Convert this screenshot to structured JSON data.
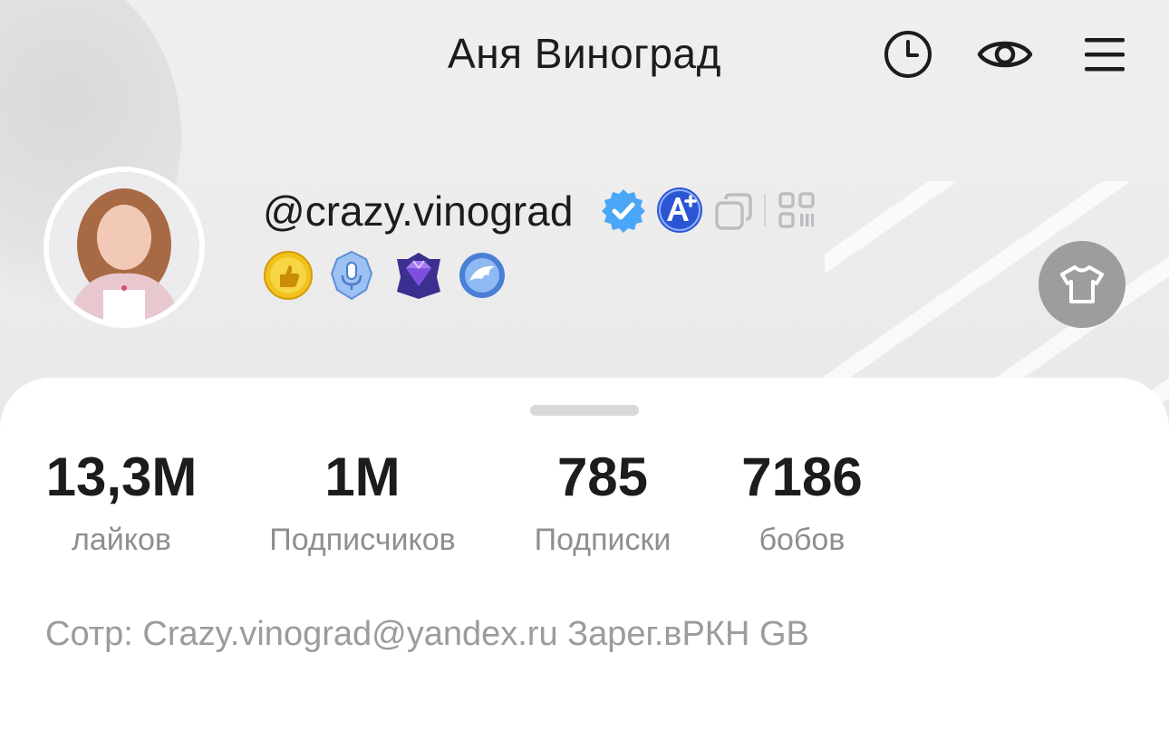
{
  "header": {
    "title": "Аня Виноград",
    "icons": [
      "history-icon",
      "eye-icon",
      "menu-icon"
    ]
  },
  "profile": {
    "username": "@crazy.vinograd",
    "badges": [
      "verified-badge-icon",
      "a-plus-badge-icon",
      "copy-icon",
      "qr-code-icon"
    ],
    "achievements": [
      "thumbs-up-achievement-icon",
      "microphone-achievement-icon",
      "diamond-achievement-icon",
      "wing-achievement-icon"
    ],
    "outfit_button_icon": "tshirt-icon"
  },
  "stats": [
    {
      "value": "13,3M",
      "label": "лайков"
    },
    {
      "value": "1M",
      "label": "Подписчиков"
    },
    {
      "value": "785",
      "label": "Подписки"
    },
    {
      "value": "7186",
      "label": "бобов"
    }
  ],
  "bio": "Сотр: Crazy.vinograd@yandex.ru Зарег.вРКН GB",
  "colors": {
    "background": "#ececed",
    "sheet": "#ffffff",
    "text_primary": "#1c1c1e",
    "text_secondary": "#8e8e93",
    "verified_blue": "#3f9ff5",
    "aplus_blue": "#2f57d6"
  }
}
